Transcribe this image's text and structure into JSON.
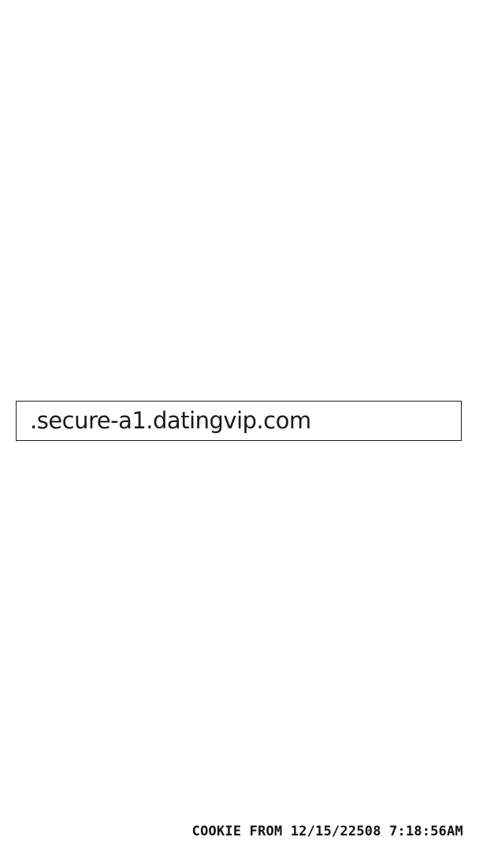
{
  "cookie": {
    "domain": ".secure-a1.datingvip.com",
    "footer_text": "COOKIE FROM 12/15/22508 7:18:56AM"
  },
  "colors": {
    "background": "#ffffff",
    "border": "#1a1a1a",
    "text": "#111111"
  }
}
